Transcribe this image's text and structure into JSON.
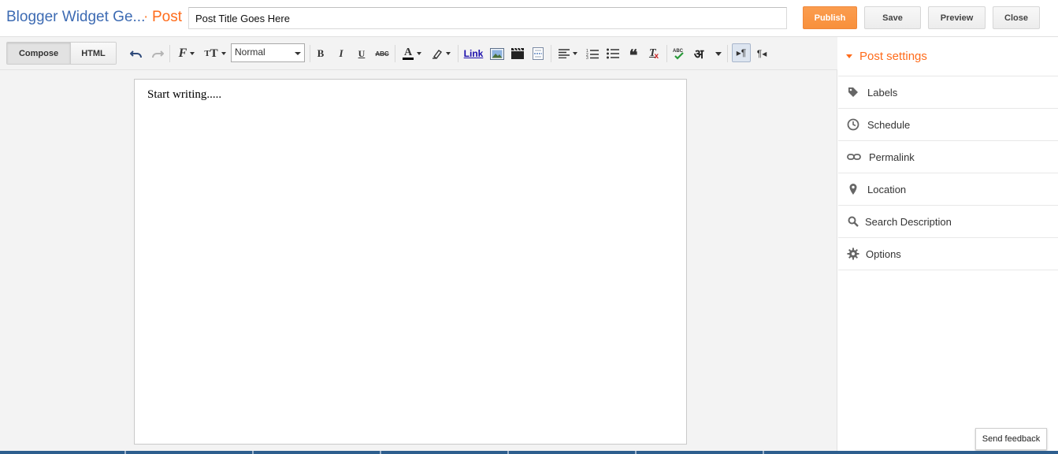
{
  "header": {
    "blog_name": "Blogger Widget Ge...",
    "separator": "·",
    "post_label": "Post",
    "title_value": "Post Title Goes Here",
    "buttons": {
      "publish": "Publish",
      "save": "Save",
      "preview": "Preview",
      "close": "Close"
    }
  },
  "toolbar": {
    "tabs": {
      "compose": "Compose",
      "html": "HTML"
    },
    "format_value": "Normal",
    "link_label": "Link",
    "hindi_glyph": "अ",
    "icons": [
      "undo-icon",
      "redo-icon",
      "font-family-icon",
      "font-size-icon",
      "bold-icon",
      "italic-icon",
      "underline-icon",
      "strikethrough-icon",
      "text-color-icon",
      "highlight-color-icon",
      "image-icon",
      "video-icon",
      "jump-break-icon",
      "align-icon",
      "numbered-list-icon",
      "bulleted-list-icon",
      "quote-icon",
      "clear-format-icon",
      "spellcheck-icon",
      "transliteration-icon",
      "ltr-icon",
      "rtl-icon"
    ]
  },
  "editor": {
    "body_text": "Start writing....."
  },
  "sidebar": {
    "heading": "Post settings",
    "items": [
      {
        "label": "Labels",
        "icon": "tag-icon"
      },
      {
        "label": "Schedule",
        "icon": "clock-icon"
      },
      {
        "label": "Permalink",
        "icon": "link-icon"
      },
      {
        "label": "Location",
        "icon": "pin-icon"
      },
      {
        "label": "Search Description",
        "icon": "search-icon"
      },
      {
        "label": "Options",
        "icon": "gear-icon"
      }
    ]
  },
  "feedback": {
    "label": "Send feedback"
  },
  "colors": {
    "accent": "#ff6b1a",
    "blog_name": "#3d6bb3",
    "publish_bg": "#f8903c"
  }
}
